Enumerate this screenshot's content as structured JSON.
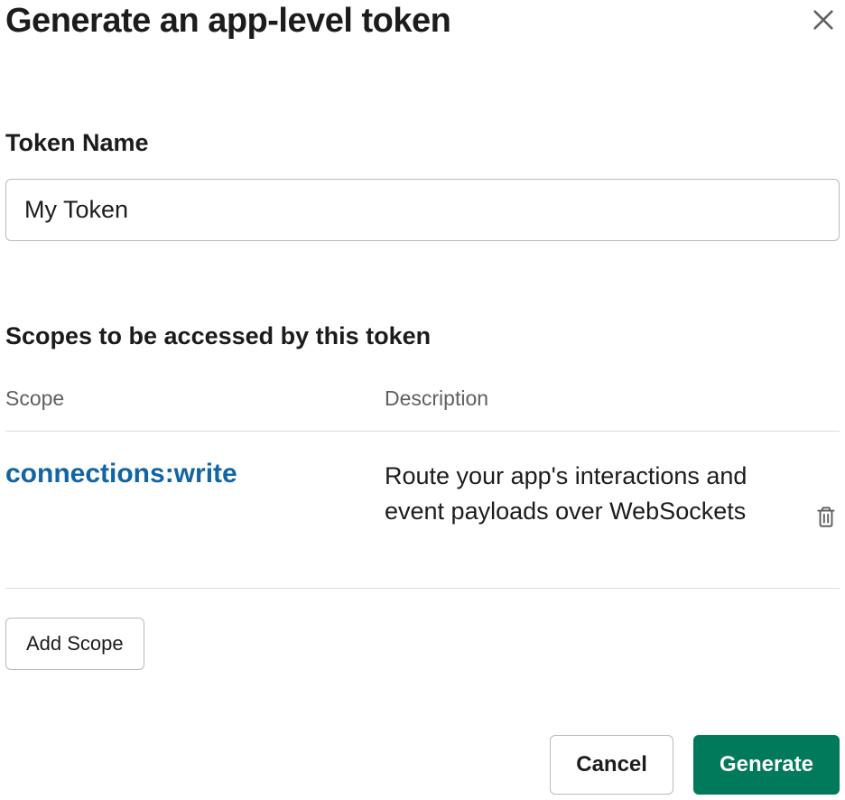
{
  "modal": {
    "title": "Generate an app-level token"
  },
  "form": {
    "token_name_label": "Token Name",
    "token_name_value": "My Token"
  },
  "scopes": {
    "heading": "Scopes to be accessed by this token",
    "col_scope": "Scope",
    "col_description": "Description",
    "rows": [
      {
        "scope": "connections:write",
        "description": "Route your app's interactions and event payloads over WebSockets"
      }
    ],
    "add_scope_label": "Add Scope"
  },
  "footer": {
    "cancel_label": "Cancel",
    "generate_label": "Generate"
  }
}
